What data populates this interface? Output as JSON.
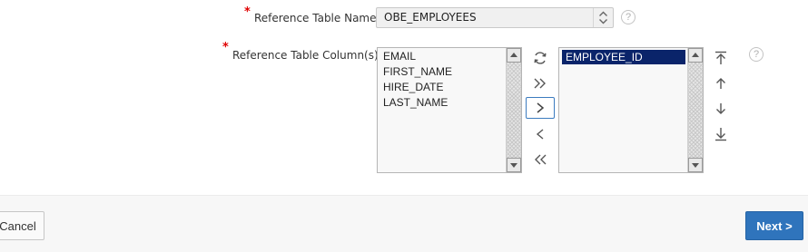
{
  "form": {
    "ref_table_name": {
      "required_marker": "*",
      "label": "Reference Table Name",
      "value": "OBE_EMPLOYEES",
      "help": "?"
    },
    "ref_table_columns": {
      "required_marker": "*",
      "label": "Reference Table Column(s)",
      "help": "?",
      "available": [
        "EMAIL",
        "FIRST_NAME",
        "HIRE_DATE",
        "LAST_NAME"
      ],
      "selected": [
        "EMPLOYEE_ID"
      ]
    }
  },
  "shuttle_controls": [
    "reset-icon",
    "move-all-icon",
    "move-icon",
    "remove-icon",
    "remove-all-icon"
  ],
  "order_controls": [
    "move-top-icon",
    "move-up-icon",
    "move-down-icon",
    "move-bottom-icon"
  ],
  "footer": {
    "cancel_label": "Cancel",
    "next_label": "Next >"
  },
  "colors": {
    "required": "#e00000",
    "primary_button": "#2f74bc",
    "selection_highlight": "#0a246a"
  }
}
